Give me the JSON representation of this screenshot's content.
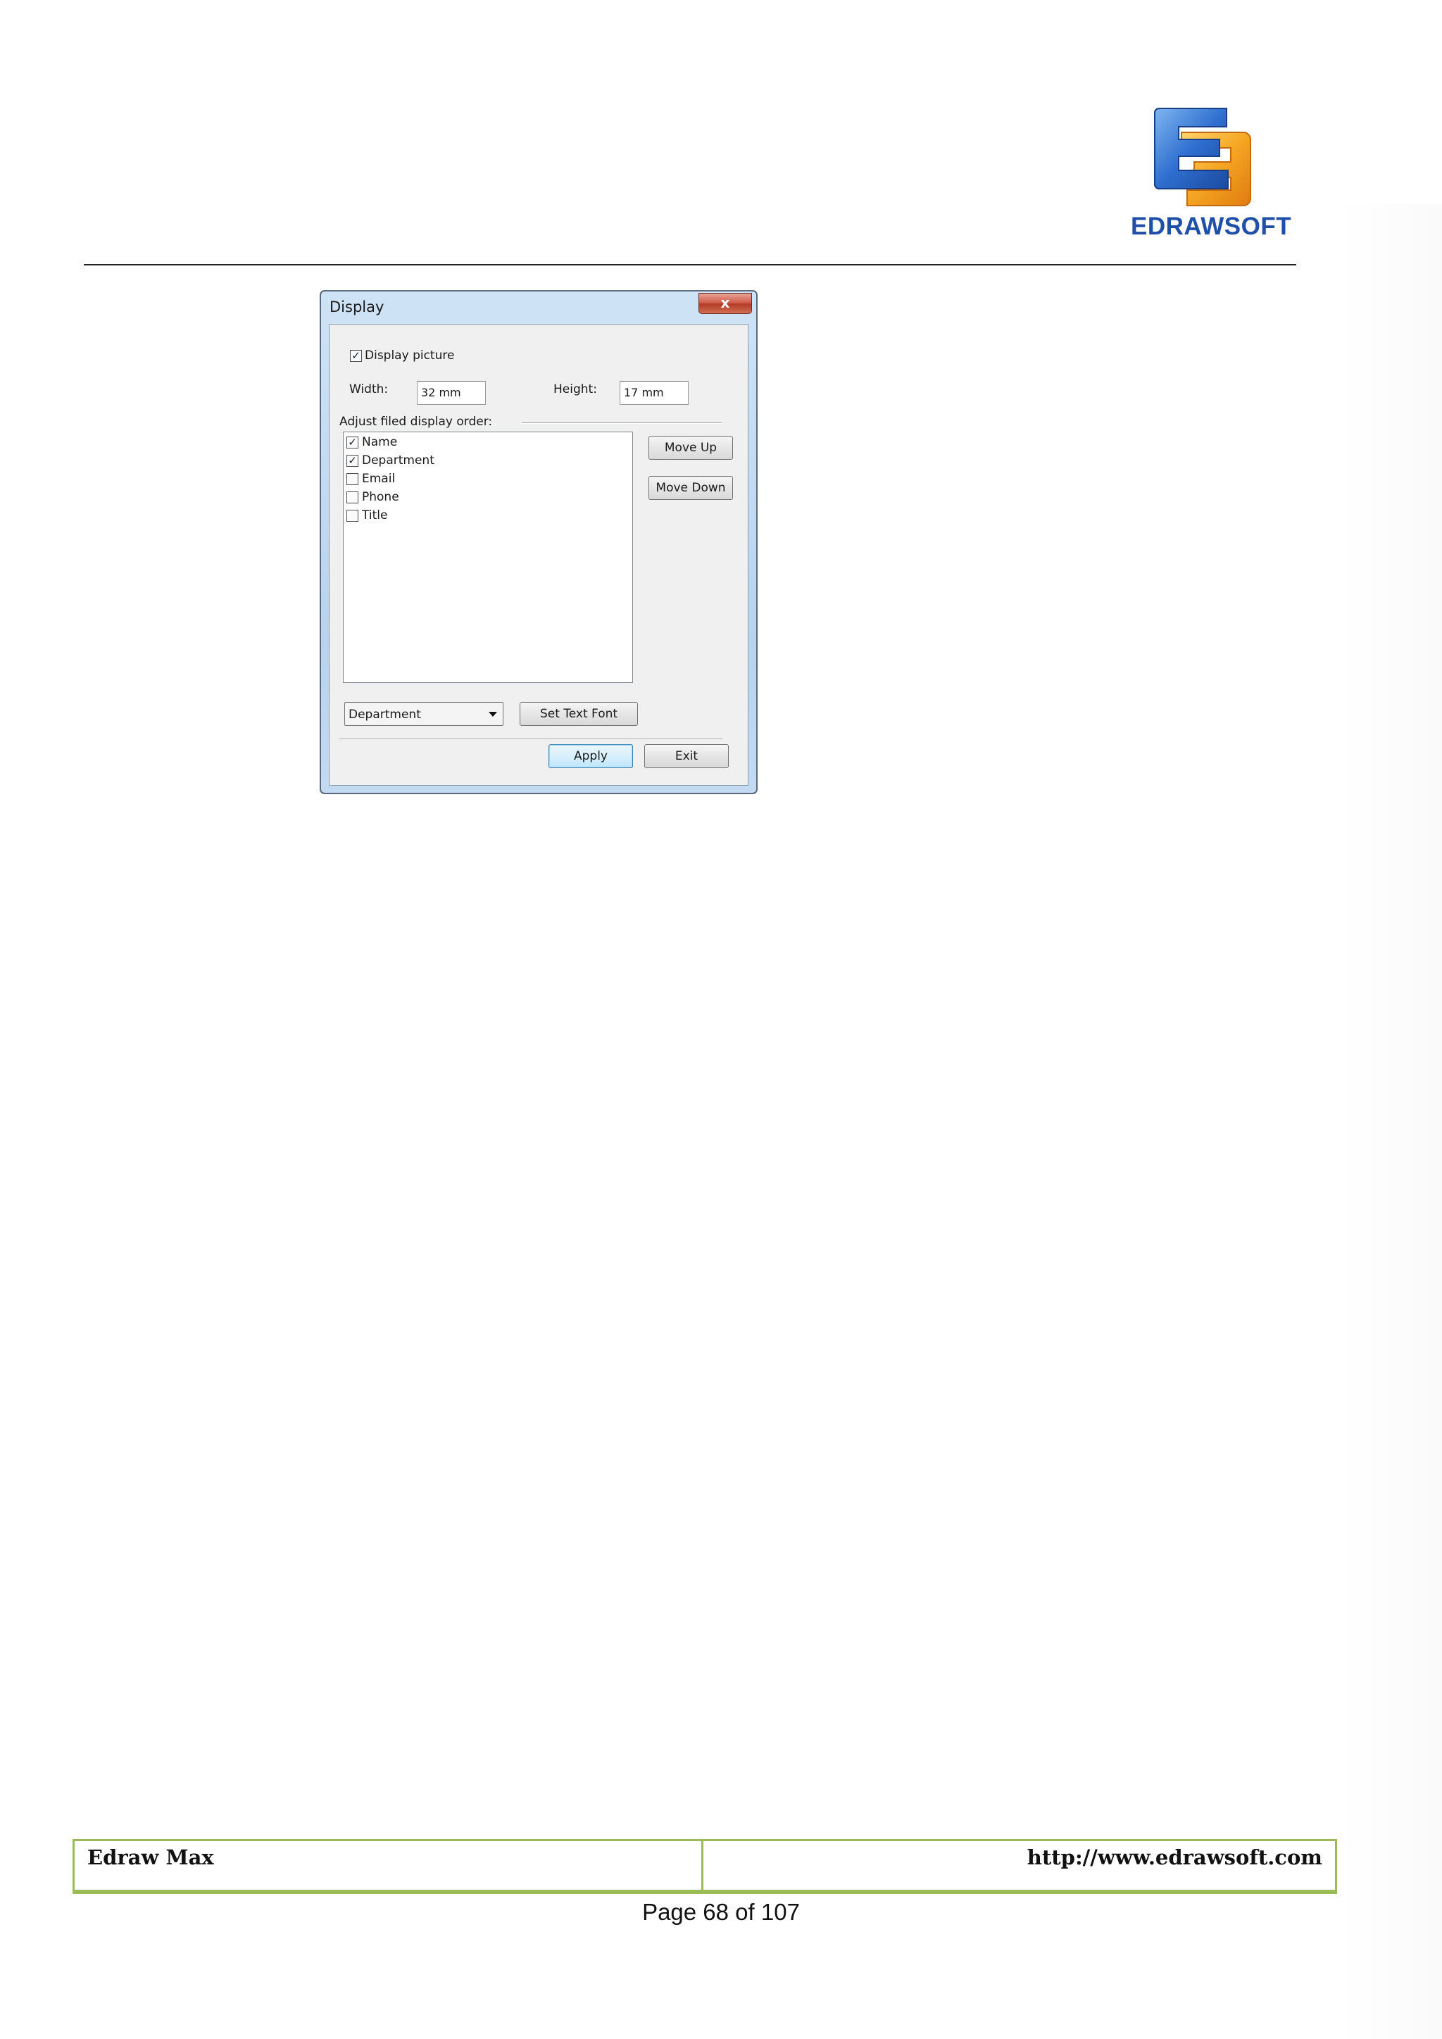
{
  "header": {
    "logo_text": "EDRAWSOFT",
    "logo_icon": "edrawsoft-logo-icon"
  },
  "dialog": {
    "title": "Display",
    "close_label": "x",
    "display_picture": {
      "label": "Display picture",
      "checked": true
    },
    "width": {
      "label": "Width:",
      "value": "32 mm"
    },
    "height": {
      "label": "Height:",
      "value": "17 mm"
    },
    "order_label": "Adjust filed display order:",
    "fields": [
      {
        "label": "Name",
        "checked": true
      },
      {
        "label": "Department",
        "checked": true
      },
      {
        "label": "Email",
        "checked": false
      },
      {
        "label": "Phone",
        "checked": false
      },
      {
        "label": "Title",
        "checked": false
      }
    ],
    "move_up": "Move Up",
    "move_down": "Move Down",
    "font_target": "Department",
    "set_text_font": "Set Text Font",
    "apply": "Apply",
    "exit": "Exit"
  },
  "footer": {
    "left": "Edraw Max",
    "right": "http://www.edrawsoft.com",
    "page": "Page 68 of 107"
  },
  "colors": {
    "footer_border": "#9bbb59",
    "logo_blue": "#1f4fa8",
    "logo_orange": "#f2a12b"
  }
}
